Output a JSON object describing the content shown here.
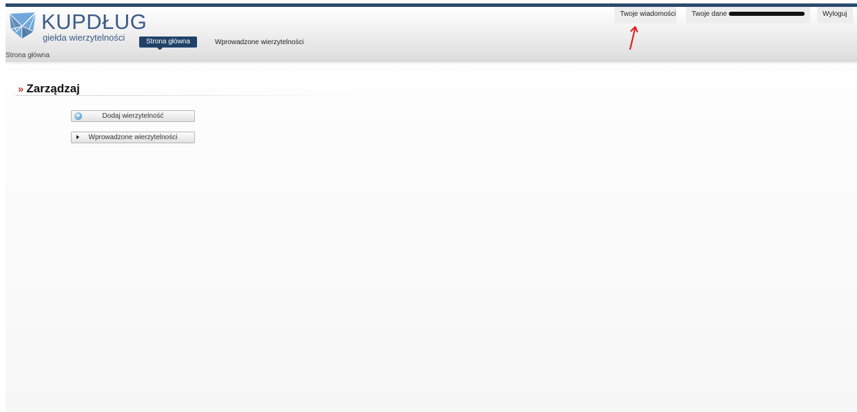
{
  "logo": {
    "title": "KUPDŁUG",
    "subtitle": "giełda wierzytelności"
  },
  "nav": {
    "home": "Strona główna",
    "entered": "Wprowadzone wierzytelności"
  },
  "top_links": {
    "messages": "Twoje wiadomości",
    "data_prefix": "Twoje dane",
    "logout": "Wyloguj"
  },
  "breadcrumb": "Strona główna",
  "section": {
    "title": "Zarządzaj"
  },
  "buttons": {
    "add": "Dodaj wierzytelność",
    "list": "Wprowadzone wierzytelności"
  },
  "colors": {
    "brand": "#3b5c86",
    "nav_active": "#1f4269",
    "accent_red": "#c0392b",
    "annotation_arrow": "#e02020"
  },
  "icons": {
    "add": "plus-circle-icon",
    "list": "triangle-right-icon"
  }
}
